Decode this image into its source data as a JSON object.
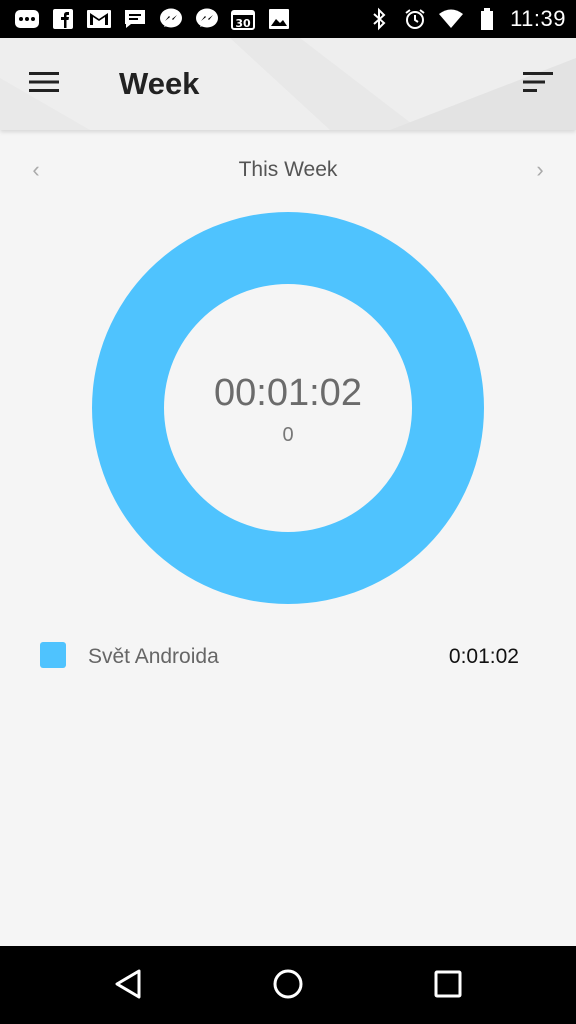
{
  "status_bar": {
    "time": "11:39",
    "left_icons": [
      "more-icon",
      "facebook-icon",
      "gmail-icon",
      "messages-icon",
      "messenger-icon",
      "messenger-icon-2",
      "calendar-icon",
      "gallery-icon"
    ],
    "right_icons": [
      "bluetooth-icon",
      "alarm-icon",
      "wifi-icon",
      "battery-icon"
    ]
  },
  "app_bar": {
    "title": "Week",
    "menu_icon": "hamburger-menu-icon",
    "sort_icon": "sort-icon"
  },
  "period": {
    "label": "This Week",
    "prev_glyph": "‹",
    "next_glyph": "›"
  },
  "summary": {
    "total_time": "00:01:02",
    "count": "0"
  },
  "chart_data": {
    "type": "pie",
    "categories": [
      "Svět Androida"
    ],
    "values": [
      62
    ],
    "colors": [
      "#4fc3fe"
    ]
  },
  "legend": [
    {
      "name": "Svět Androida",
      "value": "0:01:02",
      "color": "#4fc3fe"
    }
  ],
  "nav_bar": {
    "icons": [
      "back-icon",
      "home-icon",
      "recents-icon"
    ]
  }
}
